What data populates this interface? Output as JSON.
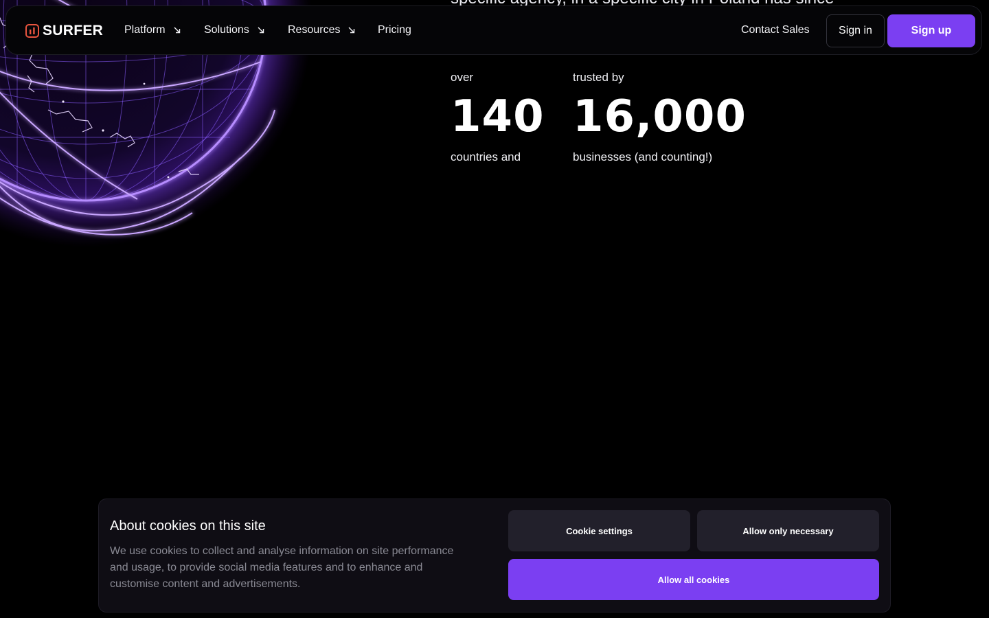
{
  "intro": {
    "text": "specific agency, in a specific city in Poland has since"
  },
  "navbar": {
    "brand": "SURFER",
    "items": [
      {
        "label": "Platform",
        "has_dropdown": true
      },
      {
        "label": "Solutions",
        "has_dropdown": true
      },
      {
        "label": "Resources",
        "has_dropdown": true
      },
      {
        "label": "Pricing",
        "has_dropdown": false
      }
    ],
    "contact_sales": "Contact Sales",
    "sign_in": "Sign in",
    "sign_up": "Sign up"
  },
  "stats": [
    {
      "pre": "over",
      "value": "140",
      "post": "countries and"
    },
    {
      "pre": "trusted by",
      "value": "16,000",
      "post": "businesses (and counting!)"
    }
  ],
  "cookie_banner": {
    "title": "About cookies on this site",
    "body": "We use cookies to collect and analyse information on site performance and usage, to provide social media features and to enhance and customise content and advertisements.",
    "settings_label": "Cookie settings",
    "necessary_label": "Allow only necessary",
    "allow_all_label": "Allow all cookies"
  },
  "colors": {
    "background": "#000000",
    "accent": "#7b3ff2",
    "logo_icon": "#e8553f",
    "banner_bg": "#0f0d14",
    "secondary_button": "#22202b",
    "muted_text": "#8a8a94"
  },
  "icons": {
    "logo": "surfer-logo-icon",
    "dropdown": "arrow-down-right-icon",
    "hero": "glowing-globe"
  }
}
